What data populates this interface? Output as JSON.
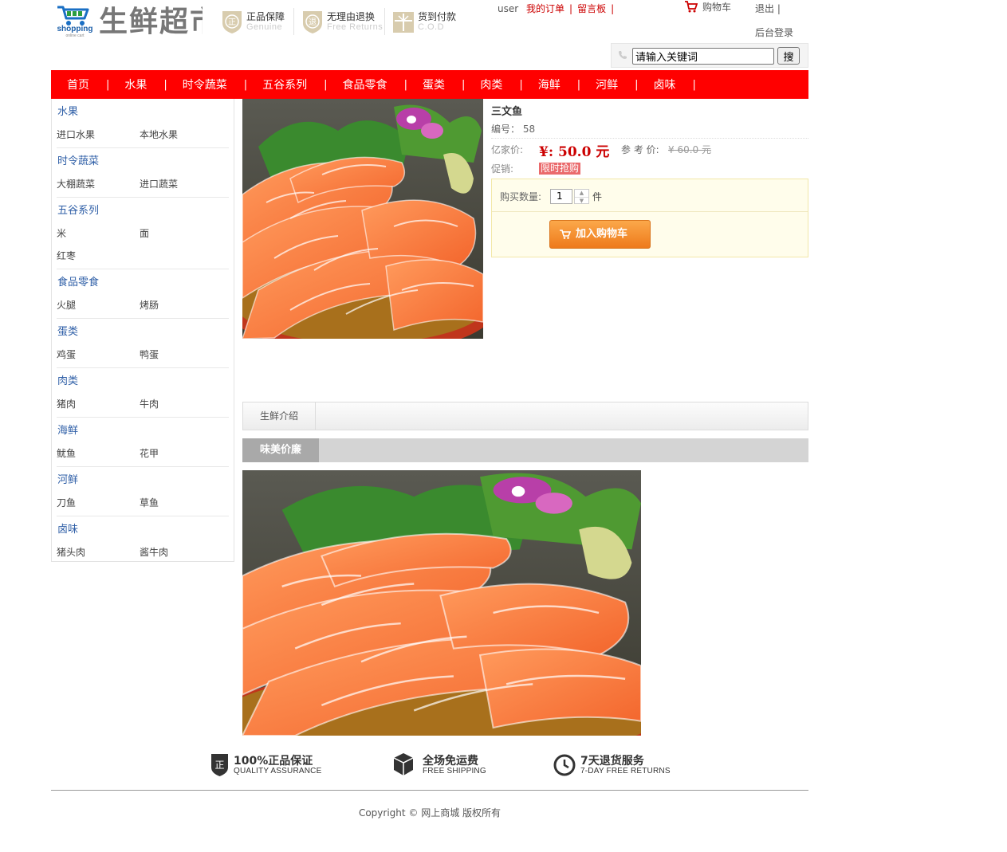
{
  "header": {
    "logo_brand": "shopping",
    "logo_tag": "online cart",
    "site_title": "生鲜超市",
    "guarantees": [
      {
        "title": "正品保障",
        "subtitle": "Genuine",
        "icon": "genuine-seal-icon"
      },
      {
        "title": "无理由退换",
        "subtitle": "Free Returns",
        "icon": "return-seal-icon"
      },
      {
        "title": "货到付款",
        "subtitle": "C.O.D",
        "icon": "cod-box-icon"
      }
    ],
    "user": "user",
    "my_orders": "我的订单",
    "message_board": "留言板",
    "cart": "购物车",
    "logout": "退出 |",
    "admin_login": "后台登录",
    "search_value": "请输入关键词",
    "search_button": "搜"
  },
  "nav": {
    "items": [
      "首页",
      "水果",
      "时令蔬菜",
      "五谷系列",
      "食品零食",
      "蛋类",
      "肉类",
      "海鲜",
      "河鲜",
      "卤味"
    ],
    "color": "#ff0000"
  },
  "sidebar": {
    "categories": [
      {
        "title": "水果",
        "items": [
          "进口水果",
          "本地水果"
        ]
      },
      {
        "title": "时令蔬菜",
        "items": [
          "大棚蔬菜",
          "进口蔬菜"
        ]
      },
      {
        "title": "五谷系列",
        "items": [
          "米",
          "面",
          "红枣"
        ]
      },
      {
        "title": "食品零食",
        "items": [
          "火腿",
          "烤肠"
        ]
      },
      {
        "title": "蛋类",
        "items": [
          "鸡蛋",
          "鸭蛋"
        ]
      },
      {
        "title": "肉类",
        "items": [
          "猪肉",
          "牛肉"
        ]
      },
      {
        "title": "海鲜",
        "items": [
          "鱿鱼",
          "花甲"
        ]
      },
      {
        "title": "河鲜",
        "items": [
          "刀鱼",
          "草鱼"
        ]
      },
      {
        "title": "卤味",
        "items": [
          "猪头肉",
          "酱牛肉"
        ]
      }
    ]
  },
  "product": {
    "name": "三文鱼",
    "sku_label": "编号：",
    "sku": "58",
    "price_label": "亿家价:",
    "price": "¥: 50.0 元",
    "ref_label": "参 考 价:",
    "ref_price": "¥ 60.0 元",
    "promo_label": "促销:",
    "promo_badge": "限时抢购",
    "qty_label": "购买数量:",
    "qty": "1",
    "qty_unit": "件",
    "add_to_cart": "加入购物车",
    "price_color": "#cc0000",
    "button_color": "#f08a25"
  },
  "tabs": {
    "intro_tab": "生鲜介绍",
    "section_title": "味美价廉"
  },
  "footer": {
    "services": [
      {
        "title": "100%正品保证",
        "subtitle": "QUALITY ASSURANCE",
        "icon": "genuine-shield-icon"
      },
      {
        "title": "全场免运费",
        "subtitle": "FREE SHIPPING",
        "icon": "package-box-icon"
      },
      {
        "title": "7天退货服务",
        "subtitle": "7-DAY FREE RETURNS",
        "icon": "clock-icon"
      }
    ],
    "copyright": "Copyright © 网上商城 版权所有"
  }
}
